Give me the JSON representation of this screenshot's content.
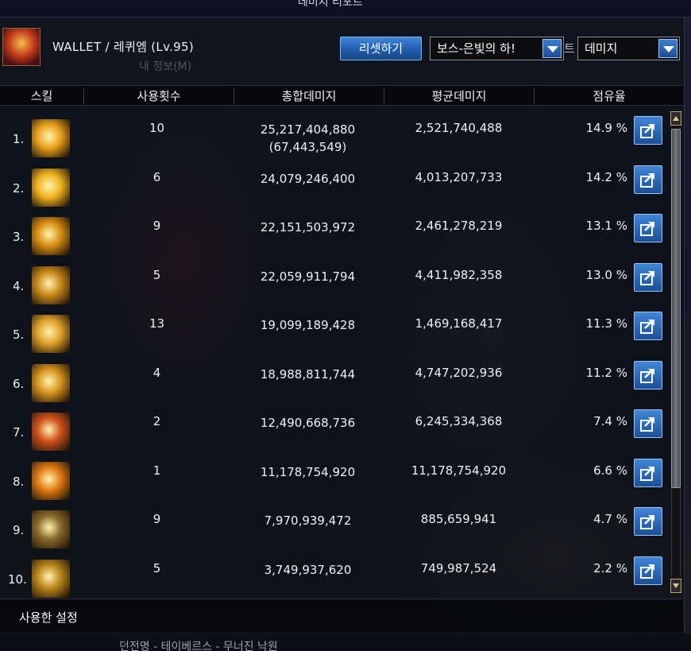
{
  "window": {
    "title": "데미지 리포트"
  },
  "header": {
    "character": "WALLET / 레퀴엠 (Lv.95)",
    "ghost_title": "내 정보(M)",
    "reset_label": "리셋하기",
    "boss_select": "보스-은빛의 하!",
    "metric_select": "데미지",
    "hidden_char": "트"
  },
  "table": {
    "columns": [
      "스킬",
      "사용횟수",
      "총합데미지",
      "평균데미지",
      "점유율"
    ],
    "rows": [
      {
        "rank": "1.",
        "uses": "10",
        "total": "25,217,404,880",
        "total_sub": "(67,443,549)",
        "avg": "2,521,740,488",
        "share": "14.9 %",
        "icon": "skill-icon-gold-figure",
        "color": "#e9a21b"
      },
      {
        "rank": "2.",
        "uses": "6",
        "total": "24,079,246,400",
        "total_sub": "",
        "avg": "4,013,207,733",
        "share": "14.2 %",
        "icon": "skill-icon-gold-burst",
        "color": "#f0b320"
      },
      {
        "rank": "3.",
        "uses": "9",
        "total": "22,151,503,972",
        "total_sub": "",
        "avg": "2,461,278,219",
        "share": "13.1 %",
        "icon": "skill-icon-gold-ring",
        "color": "#d98f12"
      },
      {
        "rank": "4.",
        "uses": "5",
        "total": "22,059,911,794",
        "total_sub": "",
        "avg": "4,411,982,358",
        "share": "13.0 %",
        "icon": "skill-icon-gold-swirl",
        "color": "#c9891a"
      },
      {
        "rank": "5.",
        "uses": "13",
        "total": "19,099,189,428",
        "total_sub": "",
        "avg": "1,469,168,417",
        "share": "11.3 %",
        "icon": "skill-icon-gold-orb",
        "color": "#e0a12a"
      },
      {
        "rank": "6.",
        "uses": "4",
        "total": "18,988,811,744",
        "total_sub": "",
        "avg": "4,747,202,936",
        "share": "11.2 %",
        "icon": "skill-icon-gold-rune",
        "color": "#d79420"
      },
      {
        "rank": "7.",
        "uses": "2",
        "total": "12,490,668,736",
        "total_sub": "",
        "avg": "6,245,334,368",
        "share": "7.4 %",
        "icon": "skill-icon-red-figure",
        "color": "#d0501c"
      },
      {
        "rank": "8.",
        "uses": "1",
        "total": "11,178,754,920",
        "total_sub": "",
        "avg": "11,178,754,920",
        "share": "6.6 %",
        "icon": "skill-icon-orange-slash",
        "color": "#e07a12"
      },
      {
        "rank": "9.",
        "uses": "9",
        "total": "7,970,939,472",
        "total_sub": "",
        "avg": "885,659,941",
        "share": "4.7 %",
        "icon": "skill-icon-target-cross",
        "color": "#8a6a2a"
      },
      {
        "rank": "10.",
        "uses": "5",
        "total": "3,749,937,620",
        "total_sub": "",
        "avg": "749,987,524",
        "share": "2.2 %",
        "icon": "skill-icon-gold-star",
        "color": "#b8861a"
      }
    ]
  },
  "footer": {
    "label": "사용한 설정"
  },
  "bottom_text": "던전명 - 테이베르스 - 무너진 낙원"
}
